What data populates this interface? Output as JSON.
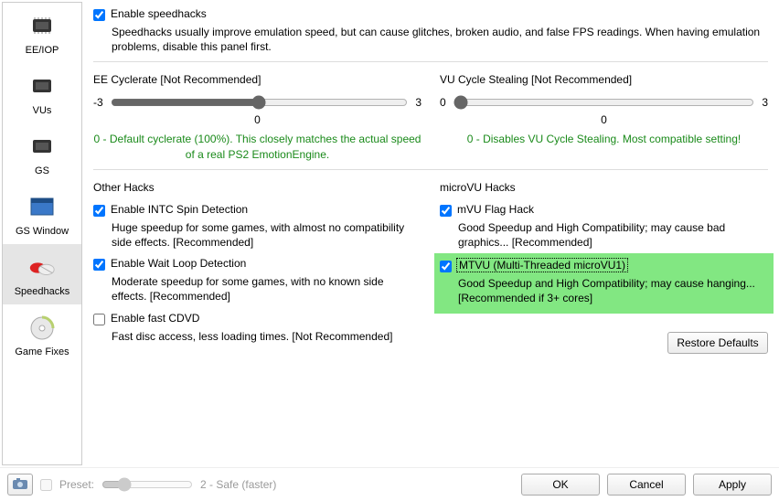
{
  "sidebar": {
    "items": [
      {
        "label": "EE/IOP"
      },
      {
        "label": "VUs"
      },
      {
        "label": "GS"
      },
      {
        "label": "GS Window"
      },
      {
        "label": "Speedhacks"
      },
      {
        "label": "Game Fixes"
      }
    ]
  },
  "enable": {
    "label": "Enable speedhacks",
    "desc": "Speedhacks usually improve emulation speed, but can cause glitches, broken audio, and false FPS readings.  When having emulation problems, disable this panel first."
  },
  "ee": {
    "title": "EE Cyclerate [Not Recommended]",
    "min": "-3",
    "max": "3",
    "val": "0",
    "note": "0 - Default cyclerate (100%). This closely matches the actual speed of a real PS2 EmotionEngine."
  },
  "vu": {
    "title": "VU Cycle Stealing [Not Recommended]",
    "min": "0",
    "max": "3",
    "val": "0",
    "note": "0 - Disables VU Cycle Stealing.  Most compatible setting!"
  },
  "other": {
    "title": "Other Hacks",
    "intc": {
      "label": "Enable INTC Spin Detection",
      "desc": "Huge speedup for some games, with almost no compatibility side effects. [Recommended]"
    },
    "wait": {
      "label": "Enable Wait Loop Detection",
      "desc": "Moderate speedup for some games, with no known side effects. [Recommended]"
    },
    "cdvd": {
      "label": "Enable fast CDVD",
      "desc": "Fast disc access, less loading times. [Not Recommended]"
    }
  },
  "micro": {
    "title": "microVU Hacks",
    "flag": {
      "label": "mVU Flag Hack",
      "desc": "Good Speedup and High Compatibility; may cause bad graphics... [Recommended]"
    },
    "mtvu": {
      "label": "MTVU (Multi-Threaded microVU1)",
      "desc": "Good Speedup and High Compatibility; may cause hanging... [Recommended if 3+ cores]"
    }
  },
  "buttons": {
    "restore": "Restore Defaults",
    "ok": "OK",
    "cancel": "Cancel",
    "apply": "Apply"
  },
  "preset": {
    "label": "Preset:",
    "value": "2 - Safe (faster)"
  }
}
